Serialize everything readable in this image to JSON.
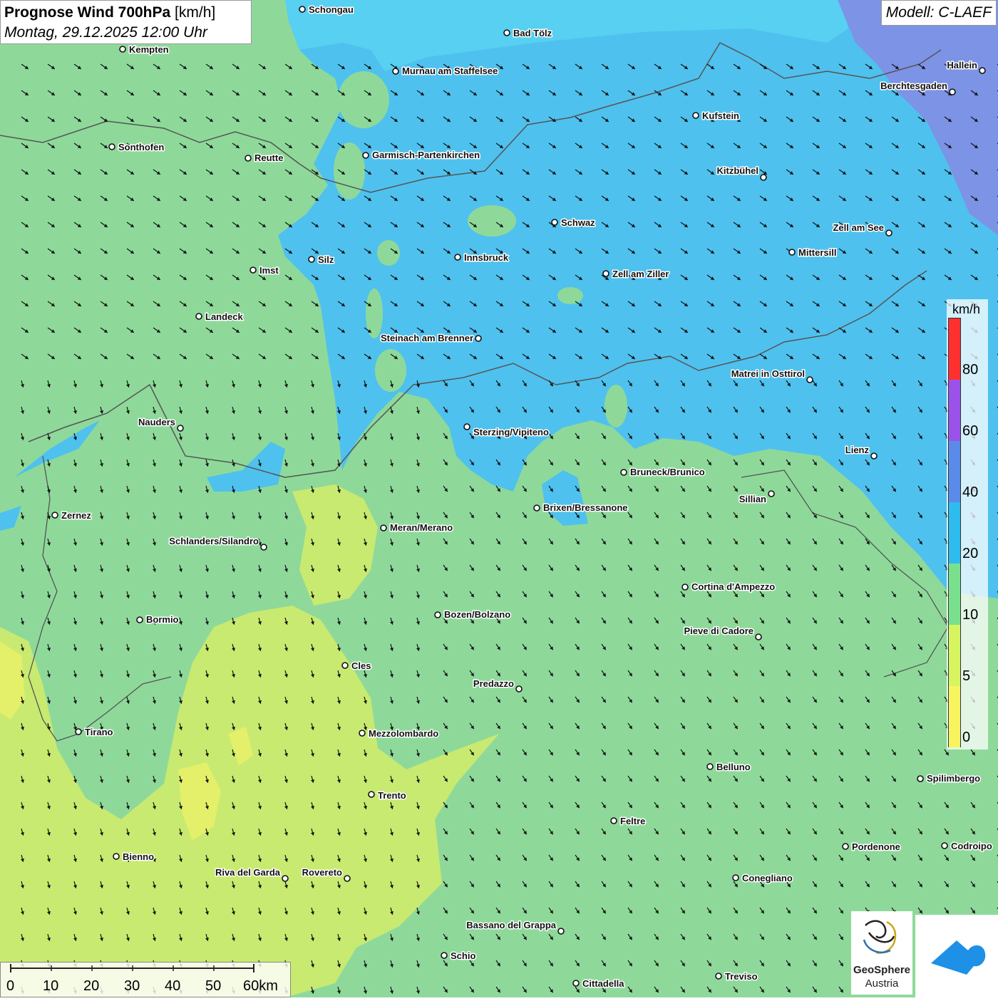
{
  "title": {
    "main_bold": "Prognose Wind 700hPa",
    "unit": "[km/h]",
    "datetime": "Montag, 29.12.2025 12:00 Uhr"
  },
  "model": "Modell: C-LAEF",
  "legend": {
    "unit": "km/h",
    "ticks": [
      "80",
      "60",
      "40",
      "20",
      "10",
      "5",
      "0"
    ],
    "colors": [
      "#ff3030",
      "#9a52e8",
      "#5a8be8",
      "#2ebcee",
      "#7ae08e",
      "#d6f560",
      "#f8f460"
    ]
  },
  "scale": {
    "labels": [
      "0",
      "10",
      "20",
      "30",
      "40",
      "50",
      "60km"
    ]
  },
  "logos": {
    "geosphere_name": "GeoSphere",
    "geosphere_sub": "Austria"
  },
  "colors": {
    "green": "#8ed99a",
    "blue": "#4fc1ee",
    "lightblue": "#57d0f1",
    "purple": "#7c93e6",
    "yellowgreen": "#c8ea70",
    "yellow": "#e4ef6a",
    "app_logo": "#1e90e6"
  },
  "cities": [
    {
      "name": "Schongau"
    },
    {
      "name": "Bad Tölz"
    },
    {
      "name": "Kempten"
    },
    {
      "name": "Murnau am Staffelsee"
    },
    {
      "name": "Hallein"
    },
    {
      "name": "Berchtesgaden"
    },
    {
      "name": "Kufstein"
    },
    {
      "name": "Sonthofen"
    },
    {
      "name": "Reutte"
    },
    {
      "name": "Garmisch-Partenkirchen"
    },
    {
      "name": "Kitzbühel"
    },
    {
      "name": "Schwaz"
    },
    {
      "name": "Zell am See"
    },
    {
      "name": "Silz"
    },
    {
      "name": "Innsbruck"
    },
    {
      "name": "Mittersill"
    },
    {
      "name": "Imst"
    },
    {
      "name": "Zell am Ziller"
    },
    {
      "name": "Landeck"
    },
    {
      "name": "Steinach am Brenner"
    },
    {
      "name": "Matrei in Osttirol"
    },
    {
      "name": "Nauders"
    },
    {
      "name": "Sterzing/Vipiteno"
    },
    {
      "name": "Lienz"
    },
    {
      "name": "Bruneck/Brunico"
    },
    {
      "name": "Sillian"
    },
    {
      "name": "Zernez"
    },
    {
      "name": "Brixen/Bressanone"
    },
    {
      "name": "Meran/Merano"
    },
    {
      "name": "Schlanders/Silandro"
    },
    {
      "name": "Cortina d'Ampezzo"
    },
    {
      "name": "Bozen/Bolzano"
    },
    {
      "name": "Bormio"
    },
    {
      "name": "Pieve di Cadore"
    },
    {
      "name": "Cles"
    },
    {
      "name": "Predazzo"
    },
    {
      "name": "Tirano"
    },
    {
      "name": "Mezzolombardo"
    },
    {
      "name": "Belluno"
    },
    {
      "name": "Spilimbergo"
    },
    {
      "name": "Trento"
    },
    {
      "name": "Feltre"
    },
    {
      "name": "Pordenone"
    },
    {
      "name": "Codroipo"
    },
    {
      "name": "Bienno"
    },
    {
      "name": "Riva del Garda"
    },
    {
      "name": "Rovereto"
    },
    {
      "name": "Conegliano"
    },
    {
      "name": "Bassano del Grappa"
    },
    {
      "name": "Schio"
    },
    {
      "name": "Treviso"
    },
    {
      "name": "Cittadella"
    }
  ]
}
